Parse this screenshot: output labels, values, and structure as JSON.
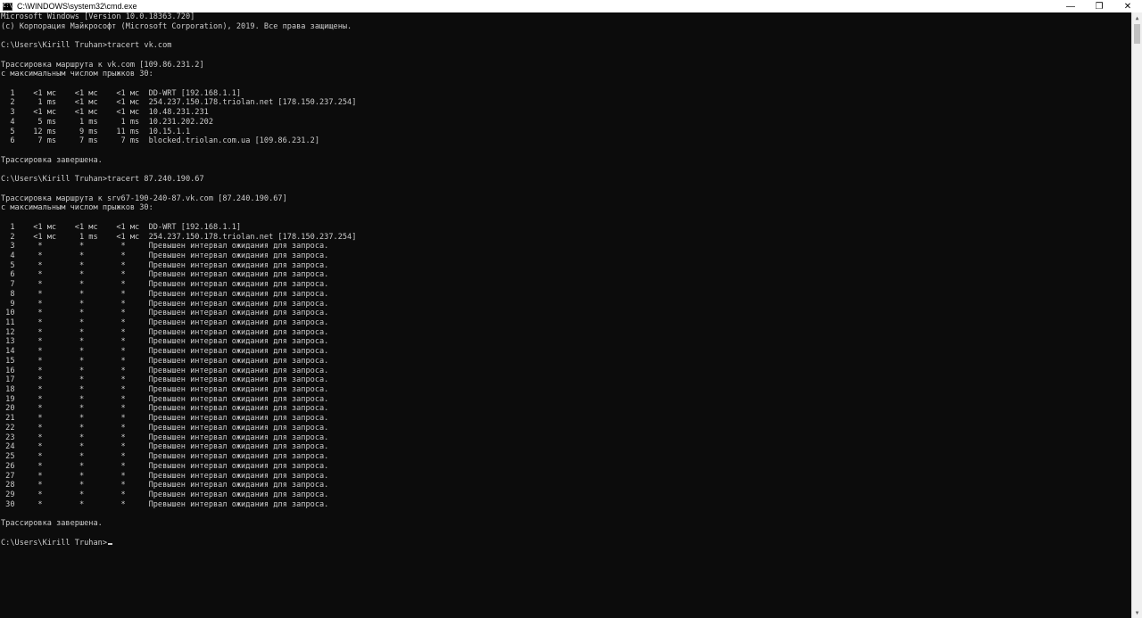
{
  "window": {
    "title": "C:\\WINDOWS\\system32\\cmd.exe",
    "icon_label": "C:\\",
    "controls": {
      "minimize": "—",
      "restore": "❐",
      "close": "✕"
    }
  },
  "console": {
    "lines": [
      "Microsoft Windows [Version 10.0.18363.720]",
      "(c) Корпорация Майкрософт (Microsoft Corporation), 2019. Все права защищены.",
      "",
      "C:\\Users\\Kirill Truhan>tracert vk.com",
      "",
      "Трассировка маршрута к vk.com [109.86.231.2]",
      "с максимальным числом прыжков 30:",
      "",
      "  1    <1 мс    <1 мс    <1 мс  DD-WRT [192.168.1.1]",
      "  2     1 ms    <1 мс    <1 мс  254.237.150.178.triolan.net [178.150.237.254]",
      "  3    <1 мс    <1 мс    <1 мс  10.48.231.231",
      "  4     5 ms     1 ms     1 ms  10.231.202.202",
      "  5    12 ms     9 ms    11 ms  10.15.1.1",
      "  6     7 ms     7 ms     7 ms  blocked.triolan.com.ua [109.86.231.2]",
      "",
      "Трассировка завершена.",
      "",
      "C:\\Users\\Kirill Truhan>tracert 87.240.190.67",
      "",
      "Трассировка маршрута к srv67-190-240-87.vk.com [87.240.190.67]",
      "с максимальным числом прыжков 30:",
      "",
      "  1    <1 мс    <1 мс    <1 мс  DD-WRT [192.168.1.1]",
      "  2    <1 мс     1 ms    <1 мс  254.237.150.178.triolan.net [178.150.237.254]",
      "  3     *        *        *     Превышен интервал ожидания для запроса.",
      "  4     *        *        *     Превышен интервал ожидания для запроса.",
      "  5     *        *        *     Превышен интервал ожидания для запроса.",
      "  6     *        *        *     Превышен интервал ожидания для запроса.",
      "  7     *        *        *     Превышен интервал ожидания для запроса.",
      "  8     *        *        *     Превышен интервал ожидания для запроса.",
      "  9     *        *        *     Превышен интервал ожидания для запроса.",
      " 10     *        *        *     Превышен интервал ожидания для запроса.",
      " 11     *        *        *     Превышен интервал ожидания для запроса.",
      " 12     *        *        *     Превышен интервал ожидания для запроса.",
      " 13     *        *        *     Превышен интервал ожидания для запроса.",
      " 14     *        *        *     Превышен интервал ожидания для запроса.",
      " 15     *        *        *     Превышен интервал ожидания для запроса.",
      " 16     *        *        *     Превышен интервал ожидания для запроса.",
      " 17     *        *        *     Превышен интервал ожидания для запроса.",
      " 18     *        *        *     Превышен интервал ожидания для запроса.",
      " 19     *        *        *     Превышен интервал ожидания для запроса.",
      " 20     *        *        *     Превышен интервал ожидания для запроса.",
      " 21     *        *        *     Превышен интервал ожидания для запроса.",
      " 22     *        *        *     Превышен интервал ожидания для запроса.",
      " 23     *        *        *     Превышен интервал ожидания для запроса.",
      " 24     *        *        *     Превышен интервал ожидания для запроса.",
      " 25     *        *        *     Превышен интервал ожидания для запроса.",
      " 26     *        *        *     Превышен интервал ожидания для запроса.",
      " 27     *        *        *     Превышен интервал ожидания для запроса.",
      " 28     *        *        *     Превышен интервал ожидания для запроса.",
      " 29     *        *        *     Превышен интервал ожидания для запроса.",
      " 30     *        *        *     Превышен интервал ожидания для запроса.",
      "",
      "Трассировка завершена.",
      ""
    ],
    "prompt": "C:\\Users\\Kirill Truhan>"
  },
  "colors": {
    "background": "#0c0c0c",
    "text": "#cccccc",
    "titlebar": "#ffffff"
  },
  "icons": {
    "app": "cmd-app-icon",
    "minimize": "minimize-icon",
    "restore": "restore-icon",
    "close": "close-icon",
    "scroll_up": "scroll-up-arrow-icon",
    "scroll_down": "scroll-down-arrow-icon"
  }
}
